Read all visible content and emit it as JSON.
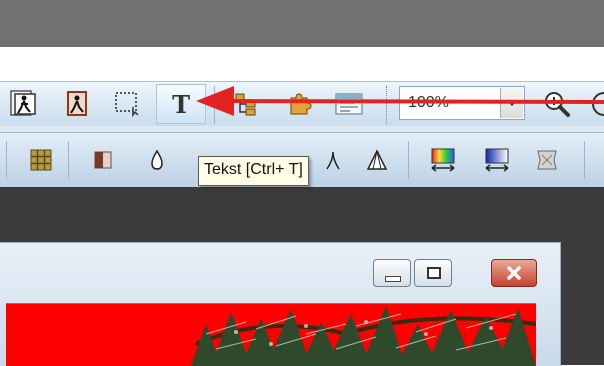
{
  "toolbar_top": {
    "zoom": {
      "value": "100%"
    }
  },
  "tooltip": {
    "text": "Tekst [Ctrl+ T]"
  },
  "icons": {
    "import": "import-person-icon",
    "export": "export-person-icon",
    "select": "rectangle-select-icon",
    "text": "text-tool-icon",
    "tree": "tree-structure-icon",
    "plugin": "puzzle-icon",
    "window": "window-list-icon",
    "zoom_in": "zoom-in-icon"
  },
  "colors": {
    "arrow": "#e32222",
    "canvas": "#ff0000",
    "close_button": "#c4442d"
  }
}
